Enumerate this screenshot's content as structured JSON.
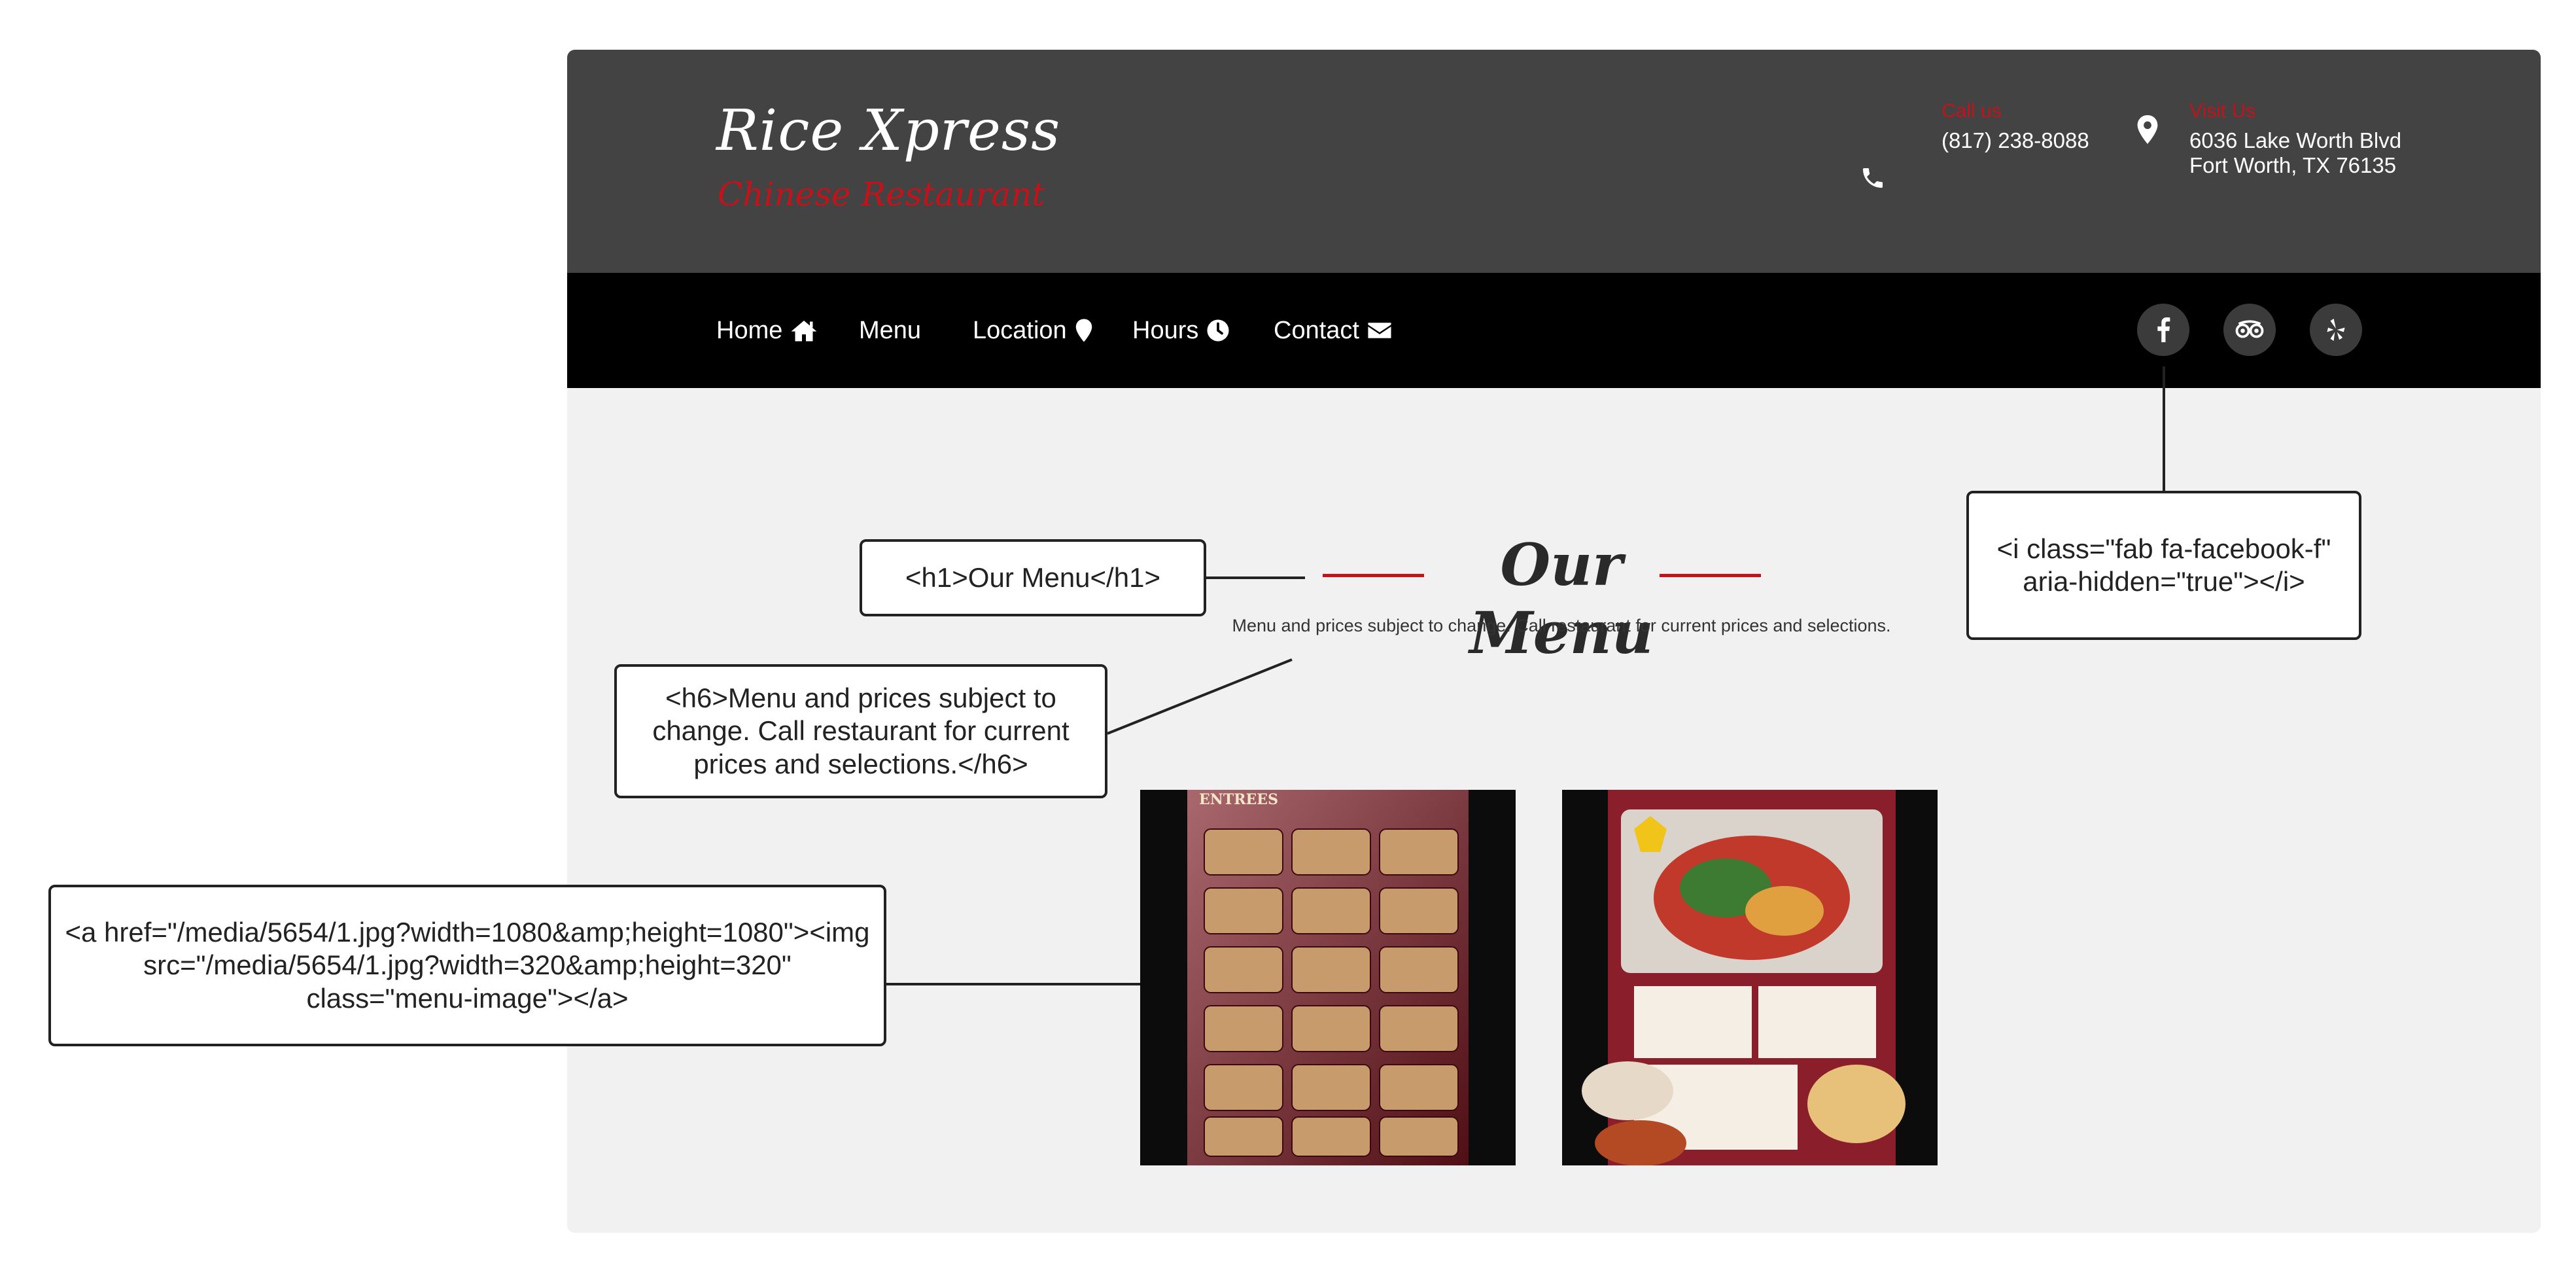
{
  "site": {
    "brand": {
      "name": "Rice Xpress",
      "tagline": "Chinese Restaurant"
    },
    "contact": {
      "call": {
        "label": "Call us",
        "value": "(817) 238-8088",
        "icon": "phone-icon"
      },
      "visit": {
        "label": "Visit Us",
        "line1": "6036 Lake Worth Blvd",
        "line2": "Fort Worth, TX 76135",
        "icon": "map-marker-icon"
      }
    },
    "nav": {
      "items": [
        {
          "label": "Home",
          "icon": "home-icon"
        },
        {
          "label": "Menu",
          "icon": ""
        },
        {
          "label": "Location",
          "icon": "map-marker-icon"
        },
        {
          "label": "Hours",
          "icon": "clock-icon"
        },
        {
          "label": "Contact",
          "icon": "envelope-icon"
        }
      ]
    },
    "social": [
      {
        "name": "facebook",
        "icon": "facebook-icon"
      },
      {
        "name": "tripadvisor",
        "icon": "tripadvisor-icon"
      },
      {
        "name": "yelp",
        "icon": "yelp-icon"
      }
    ],
    "main": {
      "title": "Our Menu",
      "subtitle": "Menu and prices subject to change. Call restaurant for current prices and selections.",
      "images": [
        {
          "alt": "Entrees menu page",
          "heading": "ENTREES"
        },
        {
          "alt": "Appetizer and specialties menu page",
          "heading": ""
        }
      ]
    }
  },
  "annotations": {
    "h1": "<h1>Our Menu</h1>",
    "h6": "<h6>Menu and prices subject to change. Call restaurant for current prices and selections.</h6>",
    "menu_link": "<a href=\"/media/5654/1.jpg?width=1080&amp;height=1080\"><img src=\"/media/5654/1.jpg?width=320&amp;height=320\" class=\"menu-image\"></a>",
    "facebook_icon": "<i class=\"fab fa-facebook-f\" aria-hidden=\"true\"></i>"
  },
  "colors": {
    "header_bg": "#434343",
    "nav_bg": "#000000",
    "accent_red": "#c4121a",
    "page_bg": "#f1f1f1"
  }
}
